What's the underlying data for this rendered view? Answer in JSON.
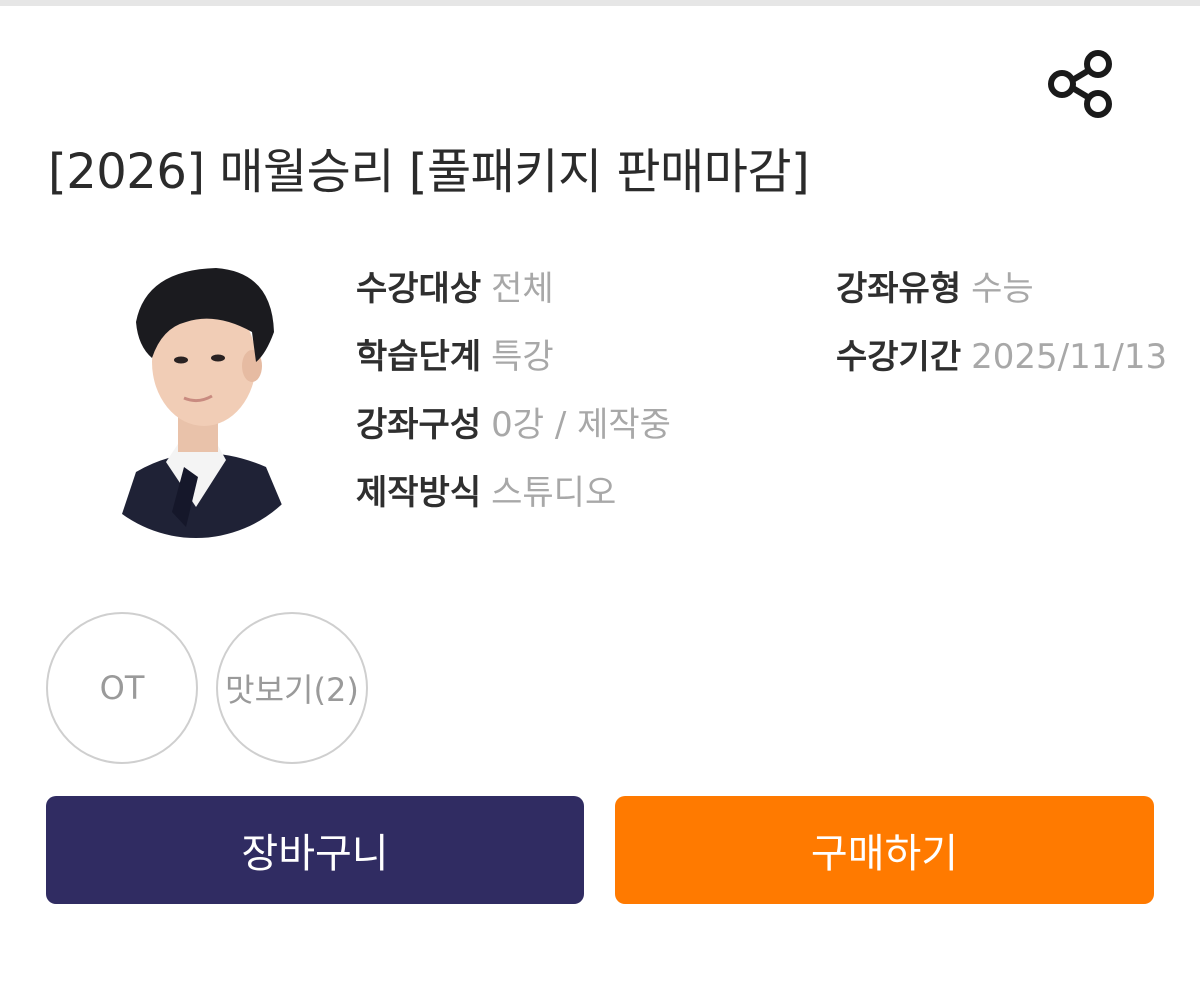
{
  "course": {
    "title": "[2026] 매월승리 [풀패키지 판매마감]"
  },
  "icons": {
    "share": "share-icon",
    "instructor": "instructor-photo"
  },
  "info": [
    {
      "label": "수강대상",
      "value": "전체"
    },
    {
      "label": "학습단계",
      "value": "특강"
    },
    {
      "label": "강좌구성",
      "value": "0강 / 제작중"
    },
    {
      "label": "제작방식",
      "value": "스튜디오"
    },
    {
      "label": "강좌유형",
      "value": "수능"
    },
    {
      "label": "수강기간",
      "value": "2025/11/13"
    }
  ],
  "preview_buttons": {
    "ot": "OT",
    "sample": "맛보기(2)"
  },
  "actions": {
    "cart": "장바구니",
    "buy": "구매하기"
  },
  "colors": {
    "cart_bg": "#302c62",
    "buy_bg": "#ff7a00",
    "label": "#2f2f2f",
    "value": "#a8a8a8"
  }
}
